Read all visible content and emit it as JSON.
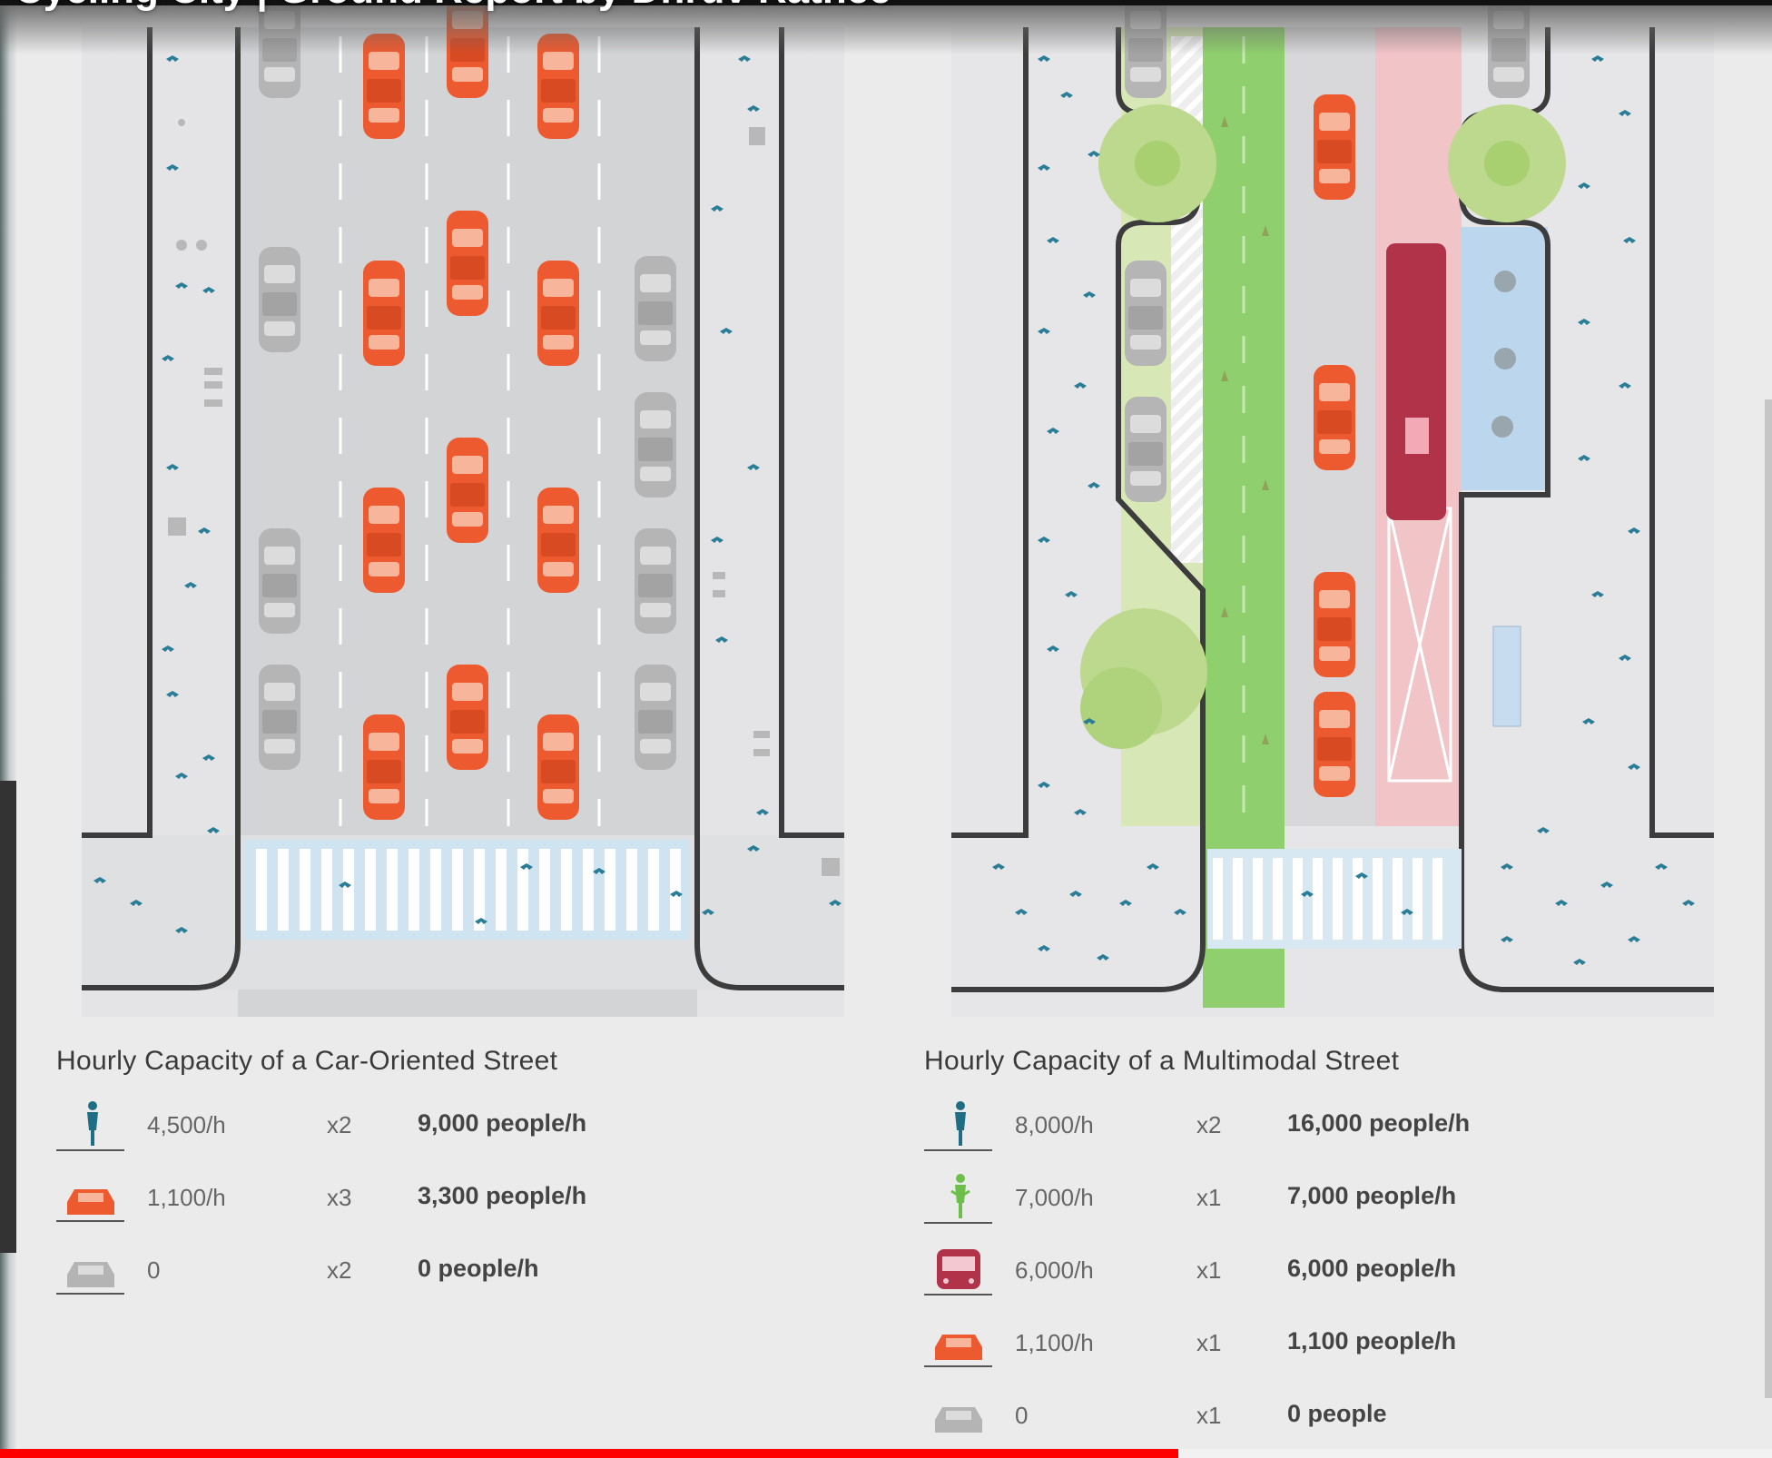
{
  "video": {
    "title": "Cycling City | Ground Report by Dhruv Rathee",
    "progress_fraction": 0.665
  },
  "colors": {
    "car_red": "#ee5a2f",
    "car_grey": "#b4b4b4",
    "bike_lane_green": "#8fcf6d",
    "bus_lane_pink": "#f1c4c8",
    "bus_maroon": "#b0334a",
    "walk_teal": "#1f6e86",
    "cafe_blue": "#bcd6ee",
    "progress_red": "#ff0000"
  },
  "car_street": {
    "title": "Hourly Capacity of a Car-Oriented Street",
    "rows": [
      {
        "icon": "pedestrian-icon",
        "rate": "4,500/h",
        "mult": "x2",
        "total": "9,000 people/h"
      },
      {
        "icon": "car-red-icon",
        "rate": "1,100/h",
        "mult": "x3",
        "total": "3,300 people/h"
      },
      {
        "icon": "car-grey-icon",
        "rate": "0",
        "mult": "x2",
        "total": "0 people/h"
      }
    ]
  },
  "multimodal_street": {
    "title": "Hourly Capacity of a Multimodal Street",
    "rows": [
      {
        "icon": "pedestrian-icon",
        "rate": "8,000/h",
        "mult": "x2",
        "total": "16,000 people/h"
      },
      {
        "icon": "cyclist-icon",
        "rate": "7,000/h",
        "mult": "x1",
        "total": "7,000 people/h"
      },
      {
        "icon": "bus-icon",
        "rate": "6,000/h",
        "mult": "x1",
        "total": "6,000 people/h"
      },
      {
        "icon": "car-red-icon",
        "rate": "1,100/h",
        "mult": "x1",
        "total": "1,100 people/h"
      },
      {
        "icon": "car-grey-icon",
        "rate": "0",
        "mult": "x1",
        "total": "0 people"
      }
    ]
  }
}
